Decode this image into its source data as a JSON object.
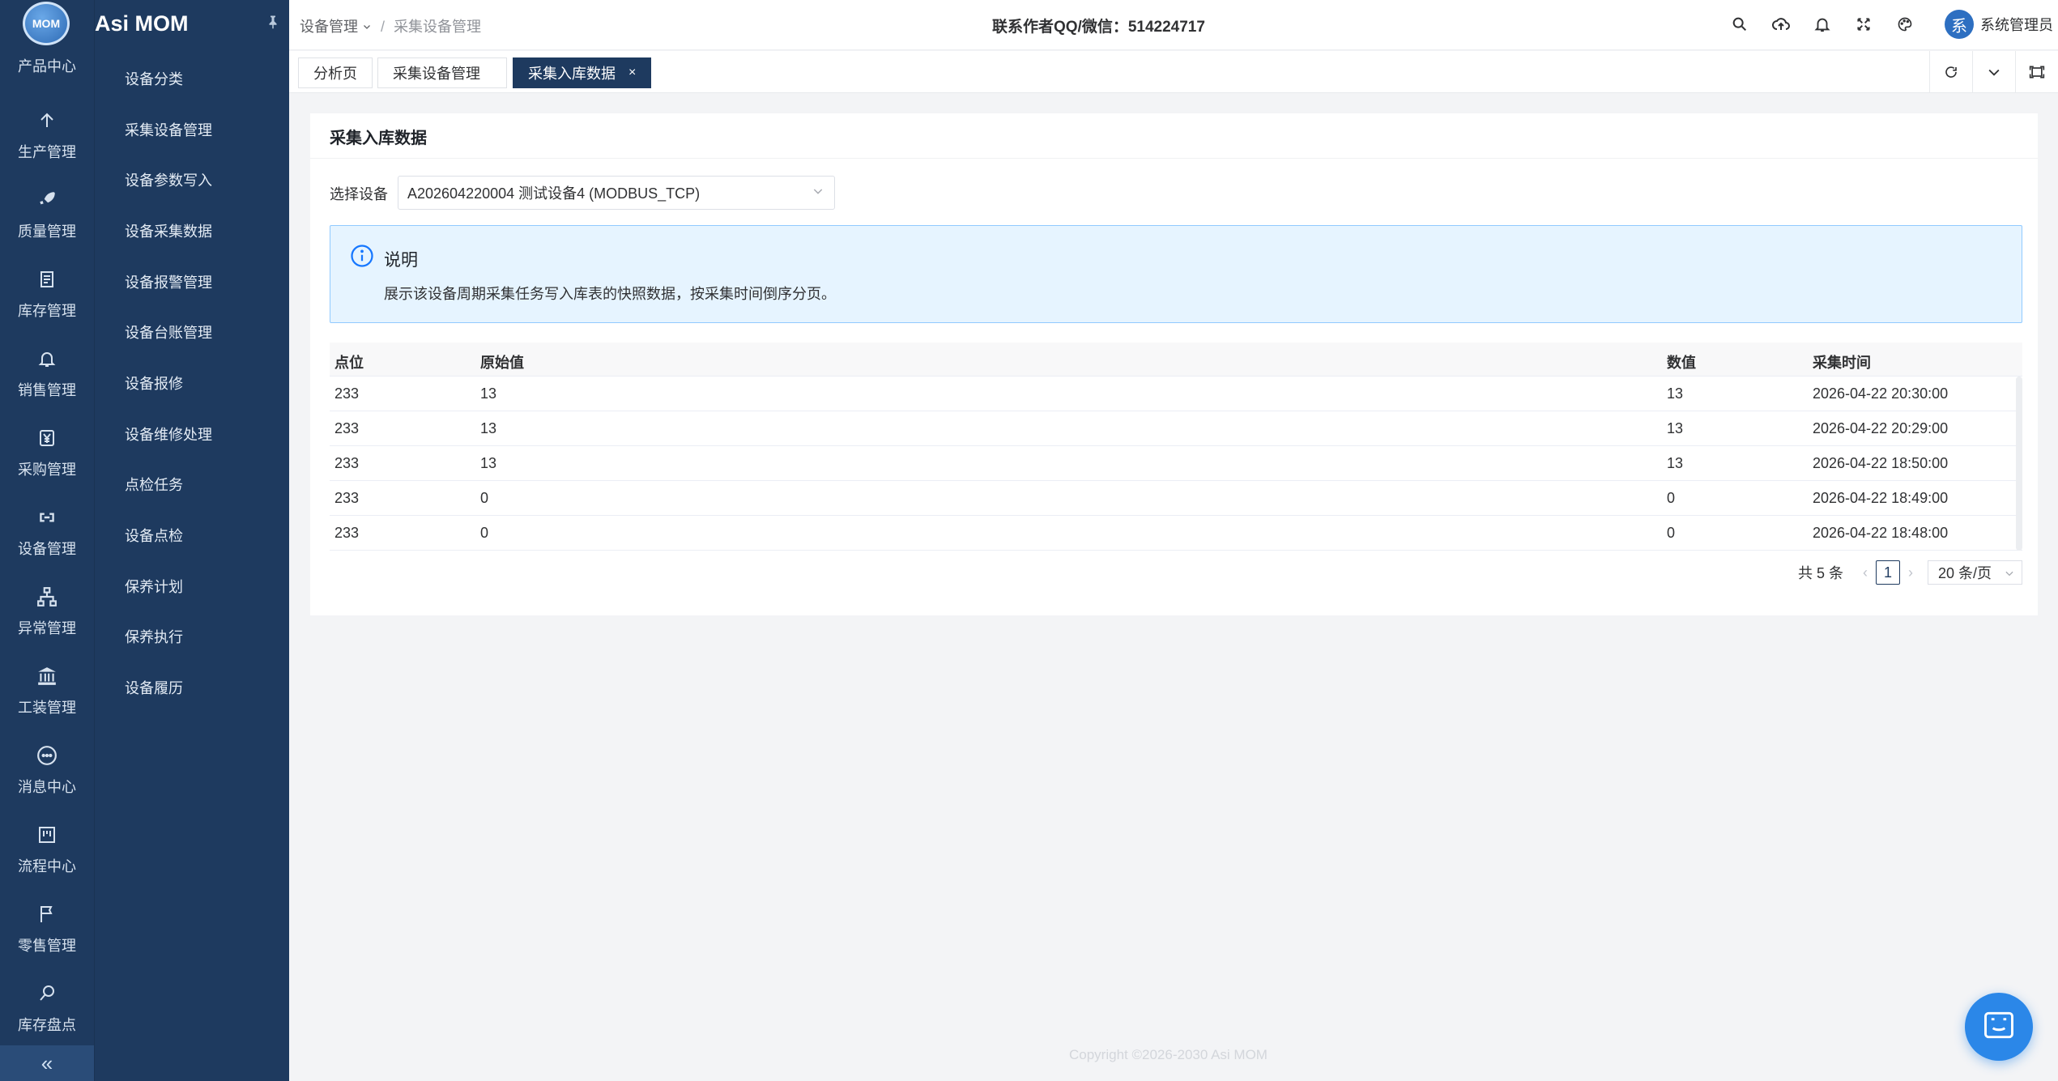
{
  "rail": {
    "logo": "MOM",
    "items": [
      {
        "label": "产品中心",
        "icon": "product-icon"
      },
      {
        "label": "生产管理",
        "icon": "arrow-up-icon"
      },
      {
        "label": "质量管理",
        "icon": "rocket-icon"
      },
      {
        "label": "库存管理",
        "icon": "inventory-icon"
      },
      {
        "label": "销售管理",
        "icon": "bell-icon"
      },
      {
        "label": "采购管理",
        "icon": "yen-icon"
      },
      {
        "label": "设备管理",
        "icon": "link-icon"
      },
      {
        "label": "异常管理",
        "icon": "org-chart-icon"
      },
      {
        "label": "工装管理",
        "icon": "bank-icon"
      },
      {
        "label": "消息中心",
        "icon": "message-icon"
      },
      {
        "label": "流程中心",
        "icon": "flow-icon"
      },
      {
        "label": "零售管理",
        "icon": "flag-icon"
      },
      {
        "label": "库存盘点",
        "icon": "search-doc-icon"
      }
    ],
    "collapse": "«"
  },
  "brand": {
    "title": "Asi MOM"
  },
  "submenu": {
    "items": [
      "设备分类",
      "采集设备管理",
      "设备参数写入",
      "设备采集数据",
      "设备报警管理",
      "设备台账管理",
      "设备报修",
      "设备维修处理",
      "点检任务",
      "设备点检",
      "保养计划",
      "保养执行",
      "设备履历"
    ]
  },
  "header": {
    "breadcrumb_root": "设备管理",
    "breadcrumb_current": "采集设备管理",
    "contact": "联系作者QQ/微信：514224717",
    "user_avatar": "系",
    "user_name": "系统管理员"
  },
  "tabs": [
    {
      "label": "分析页"
    },
    {
      "label": "采集设备管理"
    },
    {
      "label": "采集入库数据",
      "close": "×"
    }
  ],
  "card": {
    "title": "采集入库数据",
    "select_label": "选择设备",
    "select_value": "A202604220004 测试设备4 (MODBUS_TCP)",
    "info_title": "说明",
    "info_desc": "展示该设备周期采集任务写入库表的快照数据，按采集时间倒序分页。",
    "columns": [
      "点位",
      "原始值",
      "数值",
      "采集时间"
    ],
    "rows": [
      [
        "233",
        "13",
        "13",
        "2026-04-22 20:30:00"
      ],
      [
        "233",
        "13",
        "13",
        "2026-04-22 20:29:00"
      ],
      [
        "233",
        "13",
        "13",
        "2026-04-22 18:50:00"
      ],
      [
        "233",
        "0",
        "0",
        "2026-04-22 18:49:00"
      ],
      [
        "233",
        "0",
        "0",
        "2026-04-22 18:48:00"
      ]
    ],
    "pager": {
      "total": "共 5 条",
      "page": "1",
      "size": "20 条/页"
    }
  },
  "footer": "Copyright ©2026-2030 Asi MOM",
  "colors": {
    "sidebar": "#1e3a5f",
    "accent": "#2b87e8",
    "info_bg": "#e6f4ff"
  }
}
